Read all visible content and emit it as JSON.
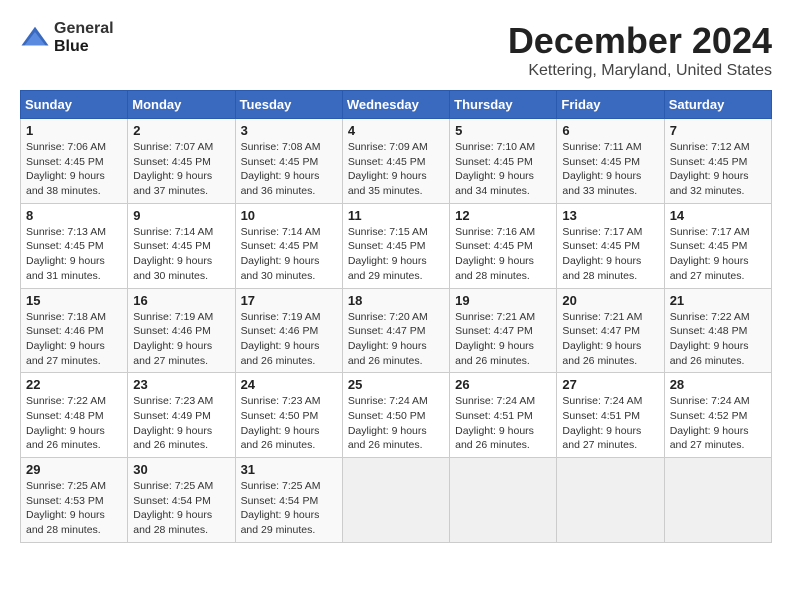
{
  "logo": {
    "line1": "General",
    "line2": "Blue"
  },
  "title": "December 2024",
  "subtitle": "Kettering, Maryland, United States",
  "days_of_week": [
    "Sunday",
    "Monday",
    "Tuesday",
    "Wednesday",
    "Thursday",
    "Friday",
    "Saturday"
  ],
  "weeks": [
    [
      {
        "day": "1",
        "sunrise": "7:06 AM",
        "sunset": "4:45 PM",
        "daylight": "9 hours and 38 minutes."
      },
      {
        "day": "2",
        "sunrise": "7:07 AM",
        "sunset": "4:45 PM",
        "daylight": "9 hours and 37 minutes."
      },
      {
        "day": "3",
        "sunrise": "7:08 AM",
        "sunset": "4:45 PM",
        "daylight": "9 hours and 36 minutes."
      },
      {
        "day": "4",
        "sunrise": "7:09 AM",
        "sunset": "4:45 PM",
        "daylight": "9 hours and 35 minutes."
      },
      {
        "day": "5",
        "sunrise": "7:10 AM",
        "sunset": "4:45 PM",
        "daylight": "9 hours and 34 minutes."
      },
      {
        "day": "6",
        "sunrise": "7:11 AM",
        "sunset": "4:45 PM",
        "daylight": "9 hours and 33 minutes."
      },
      {
        "day": "7",
        "sunrise": "7:12 AM",
        "sunset": "4:45 PM",
        "daylight": "9 hours and 32 minutes."
      }
    ],
    [
      {
        "day": "8",
        "sunrise": "7:13 AM",
        "sunset": "4:45 PM",
        "daylight": "9 hours and 31 minutes."
      },
      {
        "day": "9",
        "sunrise": "7:14 AM",
        "sunset": "4:45 PM",
        "daylight": "9 hours and 30 minutes."
      },
      {
        "day": "10",
        "sunrise": "7:14 AM",
        "sunset": "4:45 PM",
        "daylight": "9 hours and 30 minutes."
      },
      {
        "day": "11",
        "sunrise": "7:15 AM",
        "sunset": "4:45 PM",
        "daylight": "9 hours and 29 minutes."
      },
      {
        "day": "12",
        "sunrise": "7:16 AM",
        "sunset": "4:45 PM",
        "daylight": "9 hours and 28 minutes."
      },
      {
        "day": "13",
        "sunrise": "7:17 AM",
        "sunset": "4:45 PM",
        "daylight": "9 hours and 28 minutes."
      },
      {
        "day": "14",
        "sunrise": "7:17 AM",
        "sunset": "4:45 PM",
        "daylight": "9 hours and 27 minutes."
      }
    ],
    [
      {
        "day": "15",
        "sunrise": "7:18 AM",
        "sunset": "4:46 PM",
        "daylight": "9 hours and 27 minutes."
      },
      {
        "day": "16",
        "sunrise": "7:19 AM",
        "sunset": "4:46 PM",
        "daylight": "9 hours and 27 minutes."
      },
      {
        "day": "17",
        "sunrise": "7:19 AM",
        "sunset": "4:46 PM",
        "daylight": "9 hours and 26 minutes."
      },
      {
        "day": "18",
        "sunrise": "7:20 AM",
        "sunset": "4:47 PM",
        "daylight": "9 hours and 26 minutes."
      },
      {
        "day": "19",
        "sunrise": "7:21 AM",
        "sunset": "4:47 PM",
        "daylight": "9 hours and 26 minutes."
      },
      {
        "day": "20",
        "sunrise": "7:21 AM",
        "sunset": "4:47 PM",
        "daylight": "9 hours and 26 minutes."
      },
      {
        "day": "21",
        "sunrise": "7:22 AM",
        "sunset": "4:48 PM",
        "daylight": "9 hours and 26 minutes."
      }
    ],
    [
      {
        "day": "22",
        "sunrise": "7:22 AM",
        "sunset": "4:48 PM",
        "daylight": "9 hours and 26 minutes."
      },
      {
        "day": "23",
        "sunrise": "7:23 AM",
        "sunset": "4:49 PM",
        "daylight": "9 hours and 26 minutes."
      },
      {
        "day": "24",
        "sunrise": "7:23 AM",
        "sunset": "4:50 PM",
        "daylight": "9 hours and 26 minutes."
      },
      {
        "day": "25",
        "sunrise": "7:24 AM",
        "sunset": "4:50 PM",
        "daylight": "9 hours and 26 minutes."
      },
      {
        "day": "26",
        "sunrise": "7:24 AM",
        "sunset": "4:51 PM",
        "daylight": "9 hours and 26 minutes."
      },
      {
        "day": "27",
        "sunrise": "7:24 AM",
        "sunset": "4:51 PM",
        "daylight": "9 hours and 27 minutes."
      },
      {
        "day": "28",
        "sunrise": "7:24 AM",
        "sunset": "4:52 PM",
        "daylight": "9 hours and 27 minutes."
      }
    ],
    [
      {
        "day": "29",
        "sunrise": "7:25 AM",
        "sunset": "4:53 PM",
        "daylight": "9 hours and 28 minutes."
      },
      {
        "day": "30",
        "sunrise": "7:25 AM",
        "sunset": "4:54 PM",
        "daylight": "9 hours and 28 minutes."
      },
      {
        "day": "31",
        "sunrise": "7:25 AM",
        "sunset": "4:54 PM",
        "daylight": "9 hours and 29 minutes."
      },
      null,
      null,
      null,
      null
    ]
  ],
  "labels": {
    "sunrise": "Sunrise:",
    "sunset": "Sunset:",
    "daylight": "Daylight:"
  }
}
